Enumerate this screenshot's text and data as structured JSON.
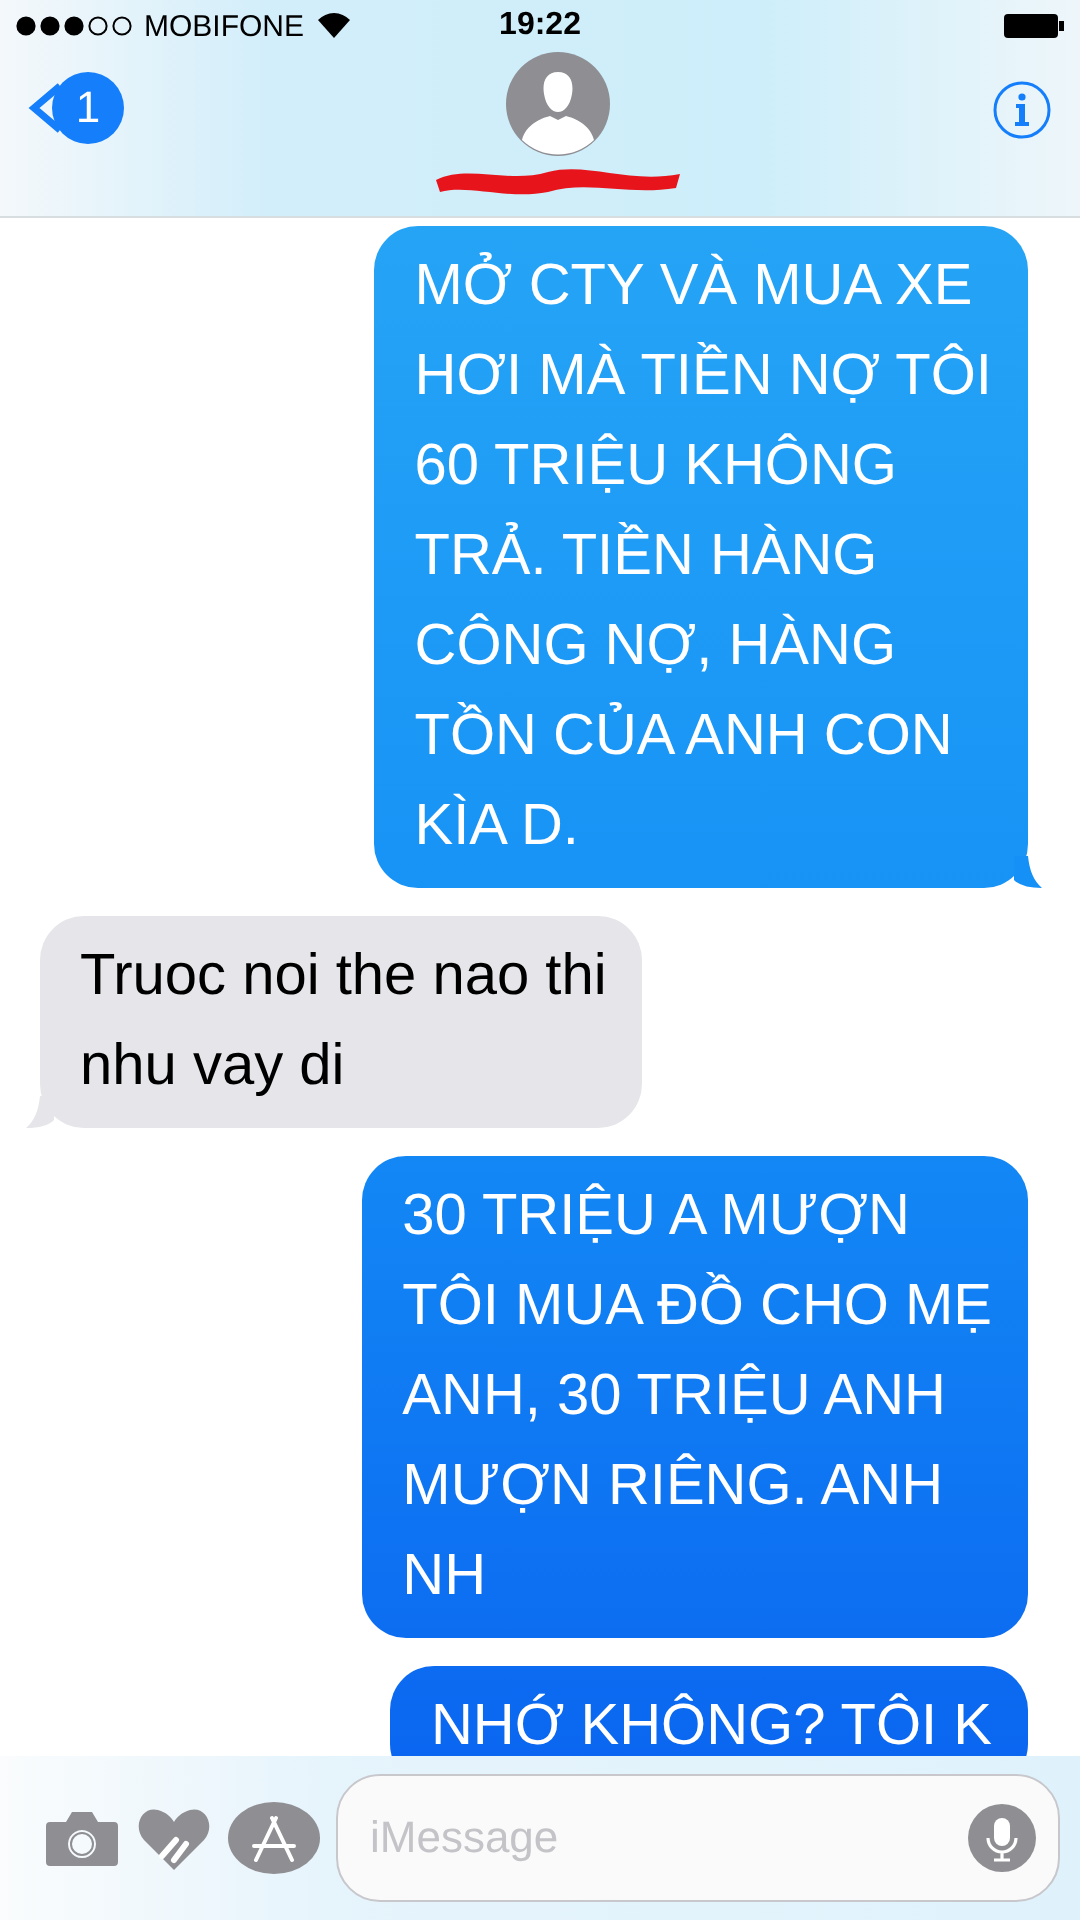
{
  "status_bar": {
    "carrier": "MOBIFONE",
    "time": "19:22"
  },
  "nav": {
    "back_badge": "1"
  },
  "messages": [
    {
      "kind": "sent",
      "text": "MỞ CTY VÀ MUA XE\nHƠI MÀ TIỀN NỢ TÔI\n60 TRIỆU KHÔNG\nTRẢ. TIỀN HÀNG\nCÔNG NỢ, HÀNG\nTỒN CỦA ANH CON\nKÌA D.",
      "tail": true
    },
    {
      "kind": "received",
      "text": "Truoc noi the nao thi\nnhu vay di",
      "tail": true
    },
    {
      "kind": "sent",
      "text": "30 TRIỆU A MƯỢN\nTÔI MUA ĐỒ CHO MẸ\nANH, 30 TRIỆU ANH\nMƯỢN RIÊNG. ANH\nNH",
      "tail": false
    },
    {
      "kind": "sent",
      "text": "NHỚ KHÔNG? TÔI K",
      "tail": false
    }
  ],
  "composer": {
    "placeholder": "iMessage"
  }
}
